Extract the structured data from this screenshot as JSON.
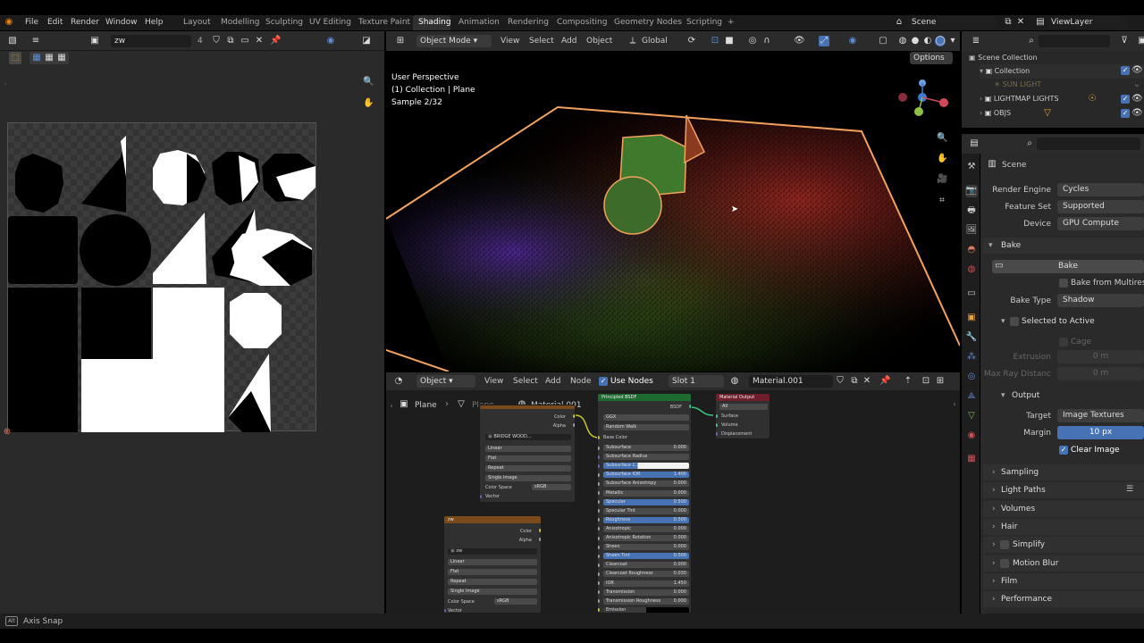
{
  "menubar": {
    "items": [
      "File",
      "Edit",
      "Render",
      "Window",
      "Help"
    ],
    "workspaces": [
      "Layout",
      "Modelling",
      "Sculpting",
      "UV Editing",
      "Texture Paint",
      "Shading",
      "Animation",
      "Rendering",
      "Compositing",
      "Geometry Nodes",
      "Scripting"
    ],
    "active_workspace": "Shading",
    "add_tab": "+",
    "scene": "Scene",
    "viewlayer": "ViewLayer"
  },
  "image_editor": {
    "image_name": "zw",
    "user_count": "4"
  },
  "viewport": {
    "mode": "Object Mode",
    "menu": [
      "View",
      "Select",
      "Add",
      "Object"
    ],
    "transform": "Global",
    "options": "Options",
    "overlay_lines": [
      "User Perspective",
      "(1) Collection | Plane",
      "Sample 2/32"
    ]
  },
  "node_editor": {
    "editor_type": "Object",
    "menu": [
      "View",
      "Select",
      "Add",
      "Node"
    ],
    "use_nodes": "Use Nodes",
    "slot": "Slot 1",
    "material": "Material.001",
    "breadcrumb_object": "Plane",
    "breadcrumb_material": "Material.001",
    "image_node_top": {
      "sockets_out": [
        "Color",
        "Alpha"
      ],
      "image_name": "BRIDGE WOOD...",
      "fields": [
        "Linear",
        "Flat",
        "Repeat",
        "Single Image"
      ],
      "colorspace_label": "Color Space",
      "colorspace": "sRGB",
      "vector": "Vector"
    },
    "image_node_bottom": {
      "title": "zw",
      "sockets_out": [
        "Color",
        "Alpha"
      ],
      "image_name": "zw",
      "fields": [
        "Linear",
        "Flat",
        "Repeat",
        "Single Image"
      ],
      "colorspace_label": "Color Space",
      "colorspace": "sRGB",
      "vector": "Vector"
    },
    "bsdf_node": {
      "title": "Principled BSDF",
      "output": "BSDF",
      "dist": "GGX",
      "sss_method": "Random Walk",
      "base_color": "Base Color",
      "rows": [
        {
          "label": "Subsurface",
          "value": "0.000"
        },
        {
          "label": "Subsurface Radius",
          "value": ""
        },
        {
          "label": "Subsurface C...",
          "value": ""
        },
        {
          "label": "Subsurface IOR",
          "value": "1.400"
        },
        {
          "label": "Subsurface Anisotropy",
          "value": "0.000"
        },
        {
          "label": "Metallic",
          "value": "0.000"
        },
        {
          "label": "Specular",
          "value": "0.500"
        },
        {
          "label": "Specular Tint",
          "value": "0.000"
        },
        {
          "label": "Roughness",
          "value": "0.500"
        },
        {
          "label": "Anisotropic",
          "value": "0.000"
        },
        {
          "label": "Anisotropic Rotation",
          "value": "0.000"
        },
        {
          "label": "Sheen",
          "value": "0.000"
        },
        {
          "label": "Sheen Tint",
          "value": "0.500"
        },
        {
          "label": "Clearcoat",
          "value": "0.000"
        },
        {
          "label": "Clearcoat Roughness",
          "value": "0.030"
        },
        {
          "label": "IOR",
          "value": "1.450"
        },
        {
          "label": "Transmission",
          "value": "0.000"
        },
        {
          "label": "Transmission Roughness",
          "value": "0.000"
        },
        {
          "label": "Emission",
          "value": ""
        }
      ]
    },
    "output_node": {
      "title": "Material Output",
      "target": "All",
      "inputs": [
        "Surface",
        "Volume",
        "Displacement"
      ]
    }
  },
  "outliner": {
    "items": [
      {
        "label": "Scene Collection"
      },
      {
        "label": "Collection"
      },
      {
        "label": "SUN LIGHT"
      },
      {
        "label": "LIGHTMAP LIGHTS"
      },
      {
        "label": "OBJS"
      }
    ]
  },
  "properties": {
    "context": "Scene",
    "render_engine_label": "Render Engine",
    "render_engine": "Cycles",
    "feature_set_label": "Feature Set",
    "feature_set": "Supported",
    "device_label": "Device",
    "device": "GPU Compute",
    "bake_panel": "Bake",
    "bake_button": "Bake",
    "bake_from_multires": "Bake from Multires",
    "bake_type_label": "Bake Type",
    "bake_type": "Shadow",
    "selected_to_active": "Selected to Active",
    "cage": "Cage",
    "extrusion_label": "Extrusion",
    "extrusion": "0 m",
    "max_ray_label": "Max Ray Distanc",
    "max_ray": "0 m",
    "output_panel": "Output",
    "target_label": "Target",
    "target": "Image Textures",
    "margin_label": "Margin",
    "margin": "10 px",
    "clear_image": "Clear Image",
    "sections": [
      "Sampling",
      "Light Paths",
      "Volumes",
      "Hair",
      "Simplify",
      "Motion Blur",
      "Film",
      "Performance"
    ]
  },
  "statusbar": {
    "hint": "Axis Snap"
  }
}
